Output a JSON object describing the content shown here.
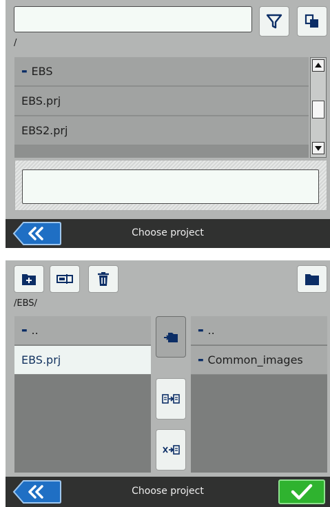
{
  "top": {
    "search": {
      "value": ""
    },
    "path": "/",
    "items": [
      {
        "label": "EBS",
        "type": "folder"
      },
      {
        "label": "EBS.prj",
        "type": "file"
      },
      {
        "label": "EBS2.prj",
        "type": "file"
      }
    ],
    "input_value": "",
    "bar_title": "Choose project"
  },
  "bottom": {
    "path": "/EBS/",
    "left_list": [
      {
        "label": "..",
        "type": "folder"
      },
      {
        "label": "EBS.prj",
        "type": "file",
        "selected": true
      }
    ],
    "right_list": [
      {
        "label": "..",
        "type": "folder"
      },
      {
        "label": "Common_images",
        "type": "folder"
      }
    ],
    "bar_title": "Choose project"
  },
  "colors": {
    "accent_blue": "#1f6fc4",
    "ok_green": "#2fb32f",
    "folder_blue": "#0c2e66"
  }
}
